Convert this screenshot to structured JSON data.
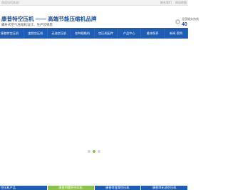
{
  "topbar": {
    "welcome": "欢迎访问本站！",
    "links": [
      "联系我们",
      "网站地图"
    ]
  },
  "header": {
    "title": "康普特空压机 —— 高端节能压缩机品牌",
    "subtitle": "螺杆式空气压缩机设计、生产及销售",
    "hotline_label": "全国服务热线",
    "hotline_number": "40"
  },
  "nav": {
    "items": [
      "康普特空压机",
      "变频空压机",
      "无油空压机",
      "各种规格机",
      "空压机配件",
      "产品中心",
      "维修保养",
      "新闻·案例"
    ]
  },
  "banner": {
    "dots": 3,
    "active_dot": 1
  },
  "tabs": {
    "items": [
      "空压机产品",
      "康普特螺杆空压机",
      "康普特变频空压机",
      "康普特无油空压机"
    ],
    "active_index": 1
  },
  "colors": {
    "primary": "#1e5db5",
    "accent": "#8bc34a",
    "title_text": "#1a4ea0"
  }
}
